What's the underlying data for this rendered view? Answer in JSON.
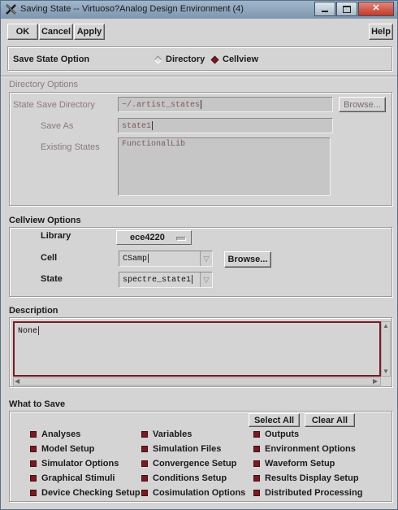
{
  "window": {
    "title": "Saving State -- Virtuoso?Analog Design Environment (4)",
    "app_icon": "x-icon"
  },
  "toolbar": {
    "ok_label": "OK",
    "cancel_label": "Cancel",
    "apply_label": "Apply",
    "help_label": "Help"
  },
  "save_state_option": {
    "label": "Save State Option",
    "options": [
      {
        "label": "Directory",
        "selected": false
      },
      {
        "label": "Cellview",
        "selected": true
      }
    ]
  },
  "directory_options": {
    "title": "Directory Options",
    "state_save_directory_label": "State Save Directory",
    "state_save_directory_value": "~/.artist_states",
    "browse_label": "Browse...",
    "save_as_label": "Save As",
    "save_as_value": "state1",
    "existing_states_label": "Existing States",
    "existing_states": [
      "FunctionalLib"
    ]
  },
  "cellview_options": {
    "title": "Cellview Options",
    "library_label": "Library",
    "library_value": "ece4220",
    "cell_label": "Cell",
    "cell_value": "CSamp",
    "browse_label": "Browse...",
    "state_label": "State",
    "state_value": "spectre_state1"
  },
  "description": {
    "title": "Description",
    "value": "None"
  },
  "what_to_save": {
    "title": "What to Save",
    "select_all_label": "Select All",
    "clear_all_label": "Clear All",
    "items": [
      {
        "label": "Analyses",
        "checked": true
      },
      {
        "label": "Variables",
        "checked": true
      },
      {
        "label": "Outputs",
        "checked": true
      },
      {
        "label": "Model Setup",
        "checked": true
      },
      {
        "label": "Simulation Files",
        "checked": true
      },
      {
        "label": "Environment Options",
        "checked": true
      },
      {
        "label": "Simulator Options",
        "checked": true
      },
      {
        "label": "Convergence Setup",
        "checked": true
      },
      {
        "label": "Waveform Setup",
        "checked": true
      },
      {
        "label": "Graphical Stimuli",
        "checked": true
      },
      {
        "label": "Conditions Setup",
        "checked": true
      },
      {
        "label": "Results Display Setup",
        "checked": true
      },
      {
        "label": "Device Checking Setup",
        "checked": true
      },
      {
        "label": "Cosimulation Options",
        "checked": true
      },
      {
        "label": "Distributed Processing",
        "checked": true
      }
    ]
  },
  "colors": {
    "accent": "#7a1a22",
    "disabled_text": "#8a7a7a",
    "titlebar": "#8ea6bd"
  }
}
